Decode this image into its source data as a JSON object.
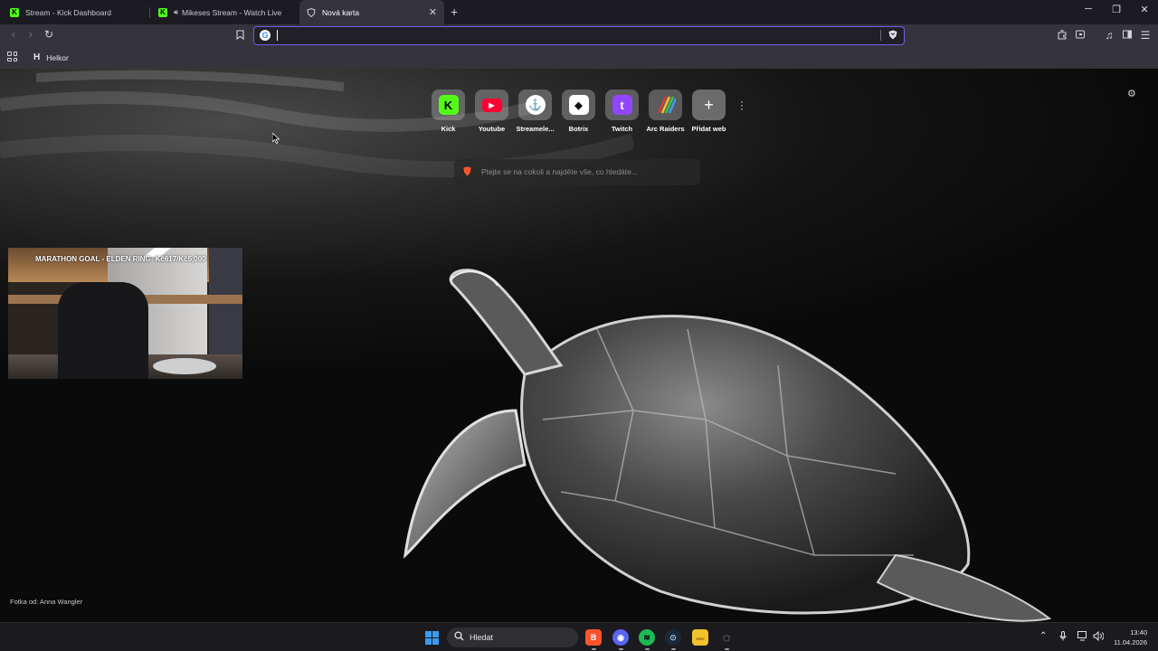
{
  "tabs": [
    {
      "title": "Stream - Kick Dashboard"
    },
    {
      "title": "Mikeses Stream - Watch Live on Kick",
      "audio": true
    },
    {
      "title": "Nová karta",
      "active": true
    }
  ],
  "window_controls": {
    "minimize": "─",
    "restore": "❐",
    "close": "✕"
  },
  "toolbar": {
    "back": "‹",
    "forward": "›",
    "reload": "↻",
    "bookmark": "⎕",
    "url_value": ""
  },
  "bookmarks_bar": {
    "items": [
      {
        "letter": "H",
        "label": "Helkor"
      }
    ]
  },
  "shortcuts": [
    {
      "label": "Kick",
      "glyph": "K",
      "bg": "#53fc18",
      "fg": "#000000"
    },
    {
      "label": "Youtube",
      "glyph": "▶",
      "bg": "#ff0033",
      "fg": "#ffffff"
    },
    {
      "label": "Streamele...",
      "glyph": "⚓",
      "bg": "#ffffff",
      "fg": "#111111"
    },
    {
      "label": "Botrix",
      "glyph": "◆",
      "bg": "#ffffff",
      "fg": "#111111"
    },
    {
      "label": "Twitch",
      "glyph": "t",
      "bg": "#9146ff",
      "fg": "#ffffff"
    },
    {
      "label": "Arc Raiders",
      "glyph": "///",
      "bg": "#2b2b2b",
      "fg": "#ffcf3a"
    },
    {
      "label": "Přidat web",
      "glyph": "+",
      "bg": "#8a8a8a",
      "fg": "#ffffff"
    }
  ],
  "search": {
    "placeholder": "Ptejte se na cokoli a najděte vše, co hledáte..."
  },
  "overlay": {
    "title": "MARATHON GOAL - ELDEN RING: Kč617/Kč5,000"
  },
  "photo_credit": "Fotka od: Anna Wangler",
  "taskbar": {
    "search_label": "Hledat",
    "apps": [
      {
        "name": "brave",
        "glyph": "B",
        "bg": "#fb542b"
      },
      {
        "name": "discord",
        "glyph": "◉",
        "bg": "#5865f2"
      },
      {
        "name": "spotify",
        "glyph": "≋",
        "bg": "#1db954"
      },
      {
        "name": "steam",
        "glyph": "⊙",
        "bg": "#1b2838"
      },
      {
        "name": "file-explorer",
        "glyph": "▬",
        "bg": "#f2c12e"
      },
      {
        "name": "other",
        "glyph": "◌",
        "bg": "#2a2a2a"
      }
    ],
    "time": "13:40",
    "date": "11.04.2026"
  },
  "colors": {
    "accent": "#7a57ee",
    "kick_green": "#53fc18"
  }
}
